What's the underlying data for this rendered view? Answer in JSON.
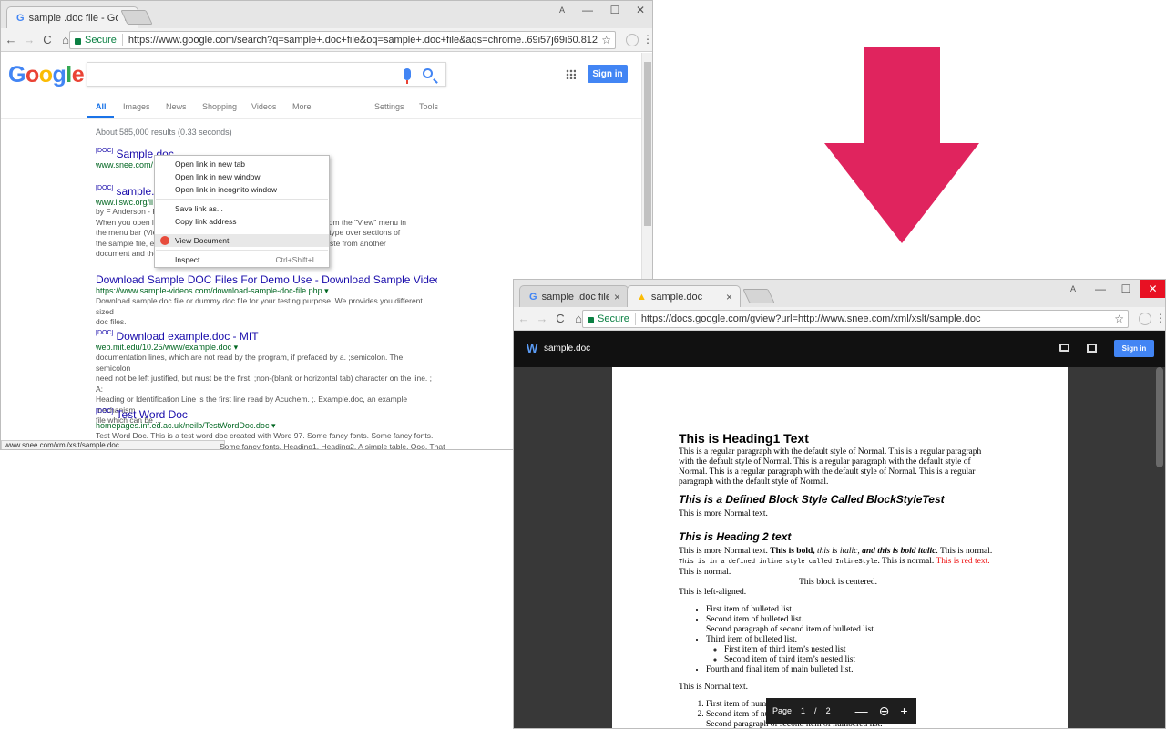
{
  "win1": {
    "tab_title": "sample .doc file - Google",
    "window_profile": "A",
    "secure_label": "Secure",
    "url": "https://www.google.com/search?q=sample+.doc+file&oq=sample+.doc+file&aqs=chrome..69i57j69i60.8123j0j4&sourceid=chrome&i...",
    "search_query": "",
    "sign_in": "Sign in",
    "tabs": [
      "All",
      "Images",
      "News",
      "Shopping",
      "Videos",
      "More",
      "Settings",
      "Tools"
    ],
    "stats": "About 585,000 results (0.33 seconds)",
    "results": [
      {
        "tag": "[DOC]",
        "title": "Sample.doc",
        "url": "www.snee.com/",
        "snippet": ""
      },
      {
        "tag": "[DOC]",
        "title": "sample.d",
        "url": "www.iiswc.org/ii",
        "snippet": "by F Anderson - R\nWhen you open le                                                                  ayout\" from the \"View\" menu in\nthe menu bar (Vie                                                                 es. Then type over sections of\nthe sample file, ei                                                                cut and paste from another\ndocument and the"
      },
      {
        "tag": "",
        "title": "Download Sample DOC Files For Demo Use - Download Sample Videos",
        "url": "https://www.sample-videos.com/download-sample-doc-file.php ▾",
        "snippet": "Download sample doc file or dummy doc file for your testing purpose. We provides you different sized\ndoc files."
      },
      {
        "tag": "[DOC]",
        "title": "Download example.doc - MIT",
        "url": "web.mit.edu/10.25/www/example.doc ▾",
        "snippet": "documentation lines, which are not read by the program, if prefaced by a. ;semicolon. The semicolon\nneed not be left justified, but must be the first. ;non-(blank or horizontal tab) character on the line. ; ; A:\nHeading or Identification Line is the first line read by Acuchem. ;. Example.doc, an example mechanism\nfile which can be ..."
      },
      {
        "tag": "[DOC]",
        "title": "Test Word Doc",
        "url": "homepages.inf.ed.ac.uk/neilb/TestWordDoc.doc ▾",
        "snippet": "Test Word Doc. This is a test word doc created with Word 97. Some fancy fonts. Some fancy fonts."
      }
    ],
    "status_url": "www.snee.com/xml/xslt/sample.doc",
    "status_trail": "Some fancy fonts. Heading1. Heading2. A simple table. Ooo. That",
    "context_menu": [
      {
        "label": "Open link in new tab",
        "shortcut": ""
      },
      {
        "label": "Open link in new window",
        "shortcut": ""
      },
      {
        "label": "Open link in incognito window",
        "shortcut": ""
      },
      {
        "label": "Save link as...",
        "shortcut": ""
      },
      {
        "label": "Copy link address",
        "shortcut": ""
      },
      {
        "label": "View Document",
        "shortcut": ""
      },
      {
        "label": "Inspect",
        "shortcut": "Ctrl+Shift+I"
      }
    ]
  },
  "win2": {
    "tab1_title": "sample .doc file - Google",
    "tab2_title": "sample.doc",
    "window_profile": "A",
    "secure_label": "Secure",
    "url": "https://docs.google.com/gview?url=http://www.snee.com/xml/xslt/sample.doc",
    "doc_title": "sample.doc",
    "sign_in": "Sign in",
    "page_label": "Page",
    "page_current": "1",
    "page_sep": "/",
    "page_total": "2",
    "doc": {
      "h1": "This is Heading1 Text",
      "p1": "This is a regular paragraph with the default style of Normal. This is a regular paragraph with the default style of Normal. This is a regular paragraph with the default style of Normal. This is a regular paragraph with the default style of Normal. This is a regular paragraph with the default style of Normal.",
      "h_block": "This is a Defined Block Style Called BlockStyleTest",
      "p2": "This is more Normal text.",
      "h2": "This is Heading 2 text",
      "p3_a": "This is more Normal text. ",
      "p3_bold": "This is bold,",
      "p3_italic": " this is italic",
      "p3_comma": ", ",
      "p3_bolditalic": "and this is bold italic",
      "p3_b": ". This is normal. ",
      "p3_mono": "This is in a defined inline style called InlineStyle",
      "p3_c": ". This is normal. ",
      "p3_red": "This is red text.",
      "p3_d": " This is normal.",
      "centered": "This block is centered.",
      "left": "This is left-aligned.",
      "bullets": [
        "First item of bulleted list.",
        "Second item of bulleted list.",
        "Second paragraph of second item of bulleted list.",
        "Third item of bulleted list.",
        "First item of third item’s nested list",
        "Second item of third item’s nested list",
        "Fourth and final item of main bulleted list."
      ],
      "p4": "This is Normal text.",
      "numbered": [
        "First item of numbered list.",
        "Second item of numbered list.",
        "Second paragraph of second item of numbered list."
      ]
    }
  },
  "colors": {
    "google_blue": "#4285f4",
    "arrow": "#e0245e",
    "link": "#1a0dab",
    "url_green": "#006621"
  }
}
